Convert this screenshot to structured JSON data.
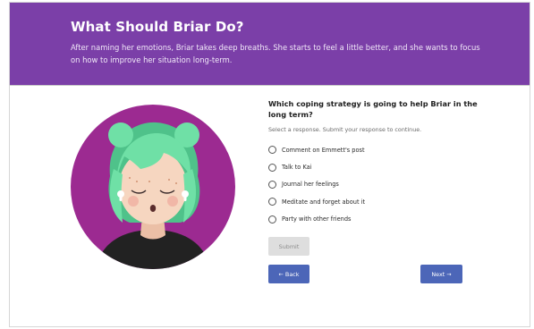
{
  "header": {
    "title": "What Should Briar Do?",
    "subtitle": "After naming her emotions, Briar takes deep breaths. She starts to feel a little better, and she wants to focus on how to improve her situation long-term."
  },
  "illustration": {
    "icon": "briar-character-illustration"
  },
  "question": {
    "text": "Which coping strategy is going to help Briar in the long term?",
    "instruction": "Select a response. Submit your response to continue.",
    "options": [
      "Comment on Emmett's post",
      "Talk to Kai",
      "Journal her feelings",
      "Meditate and forget about it",
      "Party with other friends"
    ]
  },
  "buttons": {
    "submit": "Submit",
    "back": "← Back",
    "next": "Next →"
  },
  "colors": {
    "header_bg": "#7b3fa8",
    "circle_bg": "#9c2a91",
    "hair": "#6fe0a6",
    "button_primary": "#4c66b8",
    "button_disabled": "#dedede"
  }
}
